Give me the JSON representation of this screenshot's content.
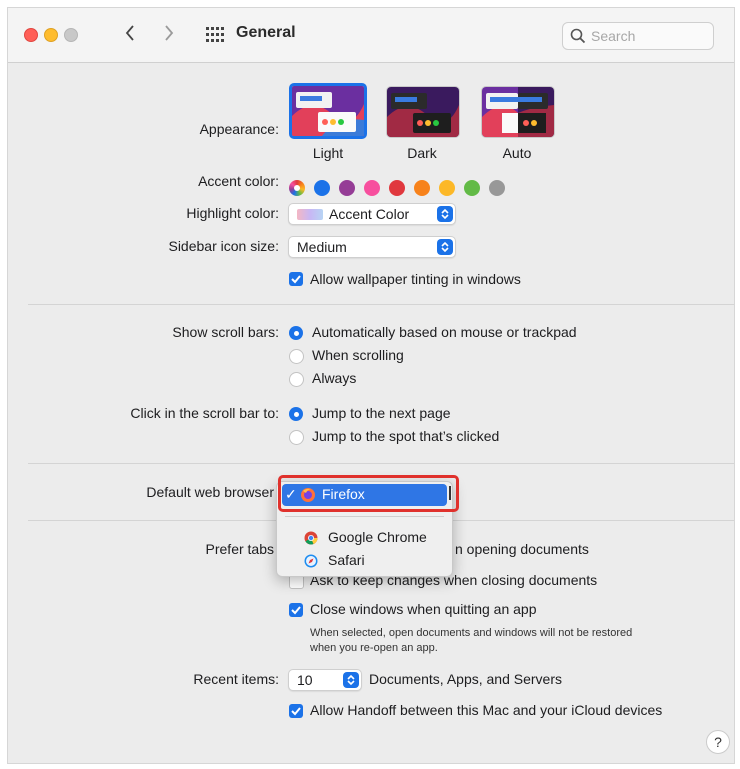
{
  "window": {
    "title": "General",
    "search_placeholder": "Search",
    "traffic_lights": [
      "#ff5f57",
      "#febc2e",
      "#c8c8c8"
    ]
  },
  "appearance": {
    "label": "Appearance:",
    "options": [
      "Light",
      "Dark",
      "Auto"
    ],
    "selected": "Light"
  },
  "accent_color": {
    "label": "Accent color:",
    "colors": [
      "multicolor",
      "#1b72e8",
      "#953d96",
      "#f74f9e",
      "#e0383e",
      "#f7821b",
      "#fcb827",
      "#62ba46",
      "#989898"
    ],
    "selected": "multicolor"
  },
  "highlight_color": {
    "label": "Highlight color:",
    "value": "Accent Color"
  },
  "sidebar_icon_size": {
    "label": "Sidebar icon size:",
    "value": "Medium"
  },
  "wallpaper_tinting": {
    "label": "Allow wallpaper tinting in windows",
    "checked": true
  },
  "scroll_bars": {
    "label": "Show scroll bars:",
    "options": [
      "Automatically based on mouse or trackpad",
      "When scrolling",
      "Always"
    ],
    "selected": "Automatically based on mouse or trackpad"
  },
  "scroll_click": {
    "label": "Click in the scroll bar to:",
    "options": [
      "Jump to the next page",
      "Jump to the spot that’s clicked"
    ],
    "selected": "Jump to the next page"
  },
  "default_browser": {
    "label": "Default web browser",
    "menu_items": [
      "Firefox",
      "Google Chrome",
      "Safari"
    ],
    "selected": "Firefox",
    "check_mark": "✓"
  },
  "prefer_tabs": {
    "label": "Prefer tabs",
    "suffix_text": "n opening documents"
  },
  "ask_keep_changes": {
    "label": "Ask to keep changes when closing documents",
    "checked": false
  },
  "close_windows": {
    "label": "Close windows when quitting an app",
    "checked": true,
    "note_line1": "When selected, open documents and windows will not be restored",
    "note_line2": "when you re-open an app."
  },
  "recent_items": {
    "label": "Recent items:",
    "value": "10",
    "suffix": "Documents, Apps, and Servers"
  },
  "handoff": {
    "label": "Allow Handoff between this Mac and your iCloud devices",
    "checked": true
  },
  "help": {
    "label": "?"
  }
}
